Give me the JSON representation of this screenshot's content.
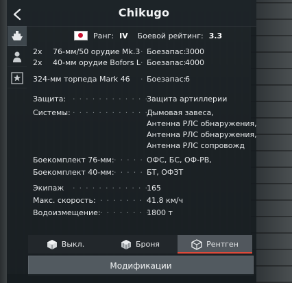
{
  "header": {
    "title": "Chikugo"
  },
  "nation": {
    "flag_icon": "japan-flag-icon"
  },
  "rank": {
    "label": "Ранг:",
    "value": "IV"
  },
  "battle_rating": {
    "label": "Боевой рейтинг:",
    "value": "3.3"
  },
  "weapons": [
    {
      "count": "2x",
      "name": "76-мм/50 орудие Mk.3",
      "ammo_label": "Боезапас:",
      "ammo": "3000"
    },
    {
      "count": "2x",
      "name": "40-мм орудие Bofors L",
      "ammo_label": "Боезапас:",
      "ammo": "4000"
    },
    {
      "count": "",
      "name": "324-мм торпеда Mark 46",
      "ammo_label": "Боезапас:",
      "ammo": "6"
    }
  ],
  "protection": {
    "label": "Защита:",
    "value": "Защита артиллерии"
  },
  "systems": {
    "label": "Системы:",
    "values": [
      "Дымовая завеса,",
      "Антенна РЛС обнаружения,",
      "Антенна РЛС обнаружения,",
      "Антенна РЛС сопровождения"
    ]
  },
  "ammo_76": {
    "label": "Боекомплект 76-мм:",
    "value": "ОФС, БС, ОФ-РВ,"
  },
  "ammo_40": {
    "label": "Боекомплект 40-мм:",
    "value": "БТ, ОФЗТ"
  },
  "crew": {
    "label": "Экипаж",
    "value": "165"
  },
  "speed": {
    "label": "Макс. скорость:",
    "value": "41.8 км/ч"
  },
  "displacement": {
    "label": "Водоизмещение:",
    "value": "1800 т"
  },
  "view_tabs": [
    {
      "label": "Выкл.",
      "icon": "cube-icon",
      "active": false
    },
    {
      "label": "Броня",
      "icon": "armor-cube-icon",
      "active": false
    },
    {
      "label": "Рентген",
      "icon": "xray-cube-icon",
      "active": true
    }
  ],
  "modifications_label": "Модификации",
  "colors": {
    "accent": "#e14a3a",
    "panel": "#161c20",
    "flag_red": "#c8102e"
  }
}
